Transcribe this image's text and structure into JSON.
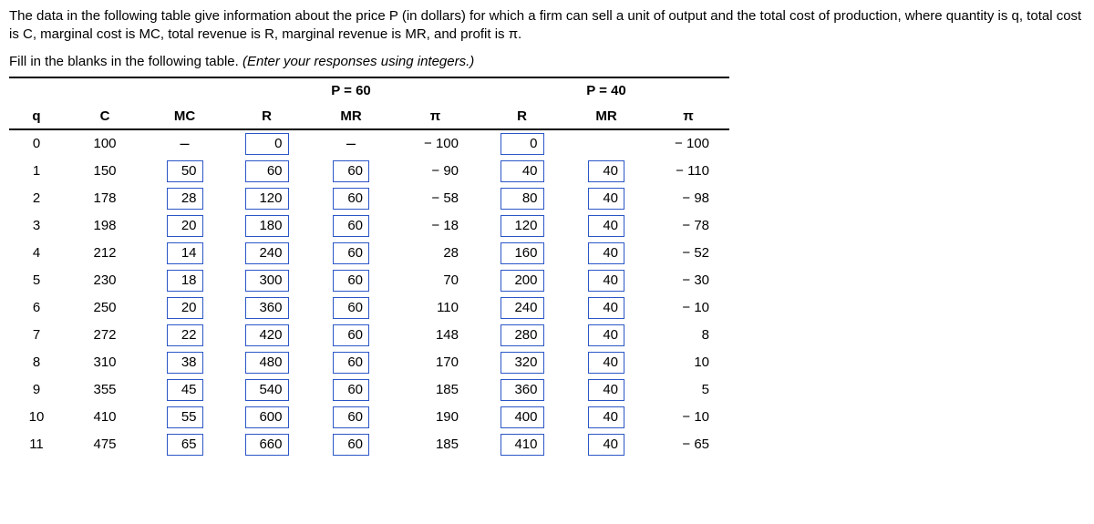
{
  "intro": "The data in the following table give information about the price P (in dollars) for which a firm can sell a unit of output and the total cost of production, where quantity is q, total cost is C, marginal cost is MC, total revenue is R, marginal revenue is MR, and profit is π.",
  "instruction_lead": "Fill in the blanks in the following table. ",
  "instruction_hint": "(Enter your responses using integers.)",
  "group_headers": {
    "p60": "P = 60",
    "p40": "P = 40"
  },
  "col_headers": {
    "q": "q",
    "c": "C",
    "mc": "MC",
    "r": "R",
    "mr": "MR",
    "pi": "π"
  },
  "dash": "–",
  "rows": [
    {
      "q": "0",
      "c": "100",
      "mc": "",
      "r1": "0",
      "mr1": "",
      "pi1": {
        "n": true,
        "v": "100"
      },
      "r2": "0",
      "mr2": "",
      "pi2": {
        "n": true,
        "v": "100"
      }
    },
    {
      "q": "1",
      "c": "150",
      "mc": "50",
      "r1": "60",
      "mr1": "60",
      "pi1": {
        "n": true,
        "v": "90"
      },
      "r2": "40",
      "mr2": "40",
      "pi2": {
        "n": true,
        "v": "110"
      }
    },
    {
      "q": "2",
      "c": "178",
      "mc": "28",
      "r1": "120",
      "mr1": "60",
      "pi1": {
        "n": true,
        "v": "58"
      },
      "r2": "80",
      "mr2": "40",
      "pi2": {
        "n": true,
        "v": "98"
      }
    },
    {
      "q": "3",
      "c": "198",
      "mc": "20",
      "r1": "180",
      "mr1": "60",
      "pi1": {
        "n": true,
        "v": "18"
      },
      "r2": "120",
      "mr2": "40",
      "pi2": {
        "n": true,
        "v": "78"
      }
    },
    {
      "q": "4",
      "c": "212",
      "mc": "14",
      "r1": "240",
      "mr1": "60",
      "pi1": {
        "n": false,
        "v": "28"
      },
      "r2": "160",
      "mr2": "40",
      "pi2": {
        "n": true,
        "v": "52"
      }
    },
    {
      "q": "5",
      "c": "230",
      "mc": "18",
      "r1": "300",
      "mr1": "60",
      "pi1": {
        "n": false,
        "v": "70"
      },
      "r2": "200",
      "mr2": "40",
      "pi2": {
        "n": true,
        "v": "30"
      }
    },
    {
      "q": "6",
      "c": "250",
      "mc": "20",
      "r1": "360",
      "mr1": "60",
      "pi1": {
        "n": false,
        "v": "110"
      },
      "r2": "240",
      "mr2": "40",
      "pi2": {
        "n": true,
        "v": "10"
      }
    },
    {
      "q": "7",
      "c": "272",
      "mc": "22",
      "r1": "420",
      "mr1": "60",
      "pi1": {
        "n": false,
        "v": "148"
      },
      "r2": "280",
      "mr2": "40",
      "pi2": {
        "n": false,
        "v": "8"
      }
    },
    {
      "q": "8",
      "c": "310",
      "mc": "38",
      "r1": "480",
      "mr1": "60",
      "pi1": {
        "n": false,
        "v": "170"
      },
      "r2": "320",
      "mr2": "40",
      "pi2": {
        "n": false,
        "v": "10"
      }
    },
    {
      "q": "9",
      "c": "355",
      "mc": "45",
      "r1": "540",
      "mr1": "60",
      "pi1": {
        "n": false,
        "v": "185"
      },
      "r2": "360",
      "mr2": "40",
      "pi2": {
        "n": false,
        "v": "5"
      }
    },
    {
      "q": "10",
      "c": "410",
      "mc": "55",
      "r1": "600",
      "mr1": "60",
      "pi1": {
        "n": false,
        "v": "190"
      },
      "r2": "400",
      "mr2": "40",
      "pi2": {
        "n": true,
        "v": "10"
      }
    },
    {
      "q": "11",
      "c": "475",
      "mc": "65",
      "r1": "660",
      "mr1": "60",
      "pi1": {
        "n": false,
        "v": "185"
      },
      "r2": "410",
      "mr2": "40",
      "pi2": {
        "n": true,
        "v": "65"
      }
    }
  ]
}
